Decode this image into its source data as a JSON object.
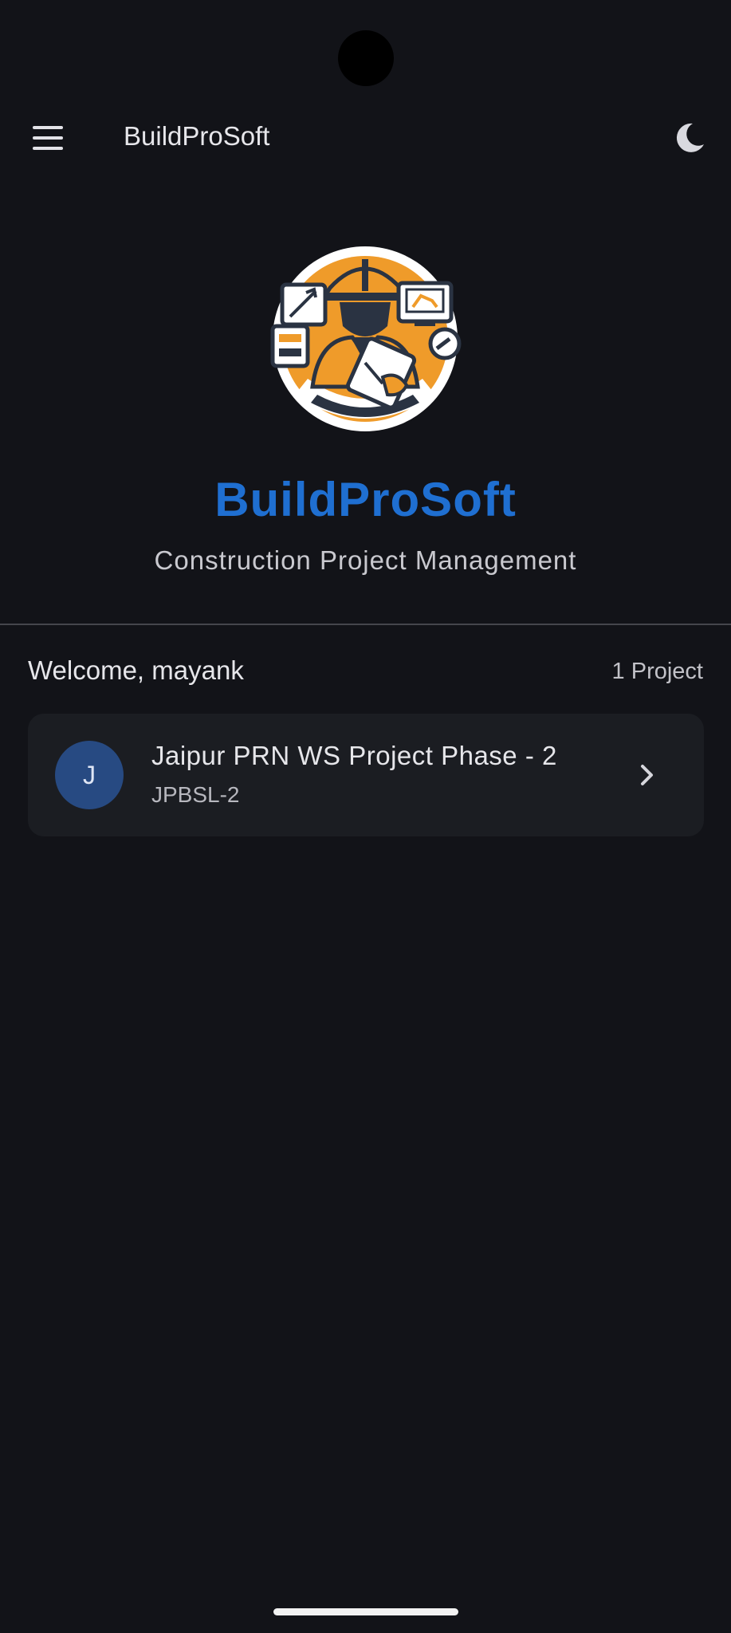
{
  "app_bar": {
    "title": "BuildProSoft",
    "menu_icon": "menu-icon",
    "theme_icon": "moon-icon"
  },
  "brand": {
    "title": "BuildProSoft",
    "subtitle": "Construction Project Management",
    "title_color": "#1f6fd1",
    "logo": "construction-worker-logo"
  },
  "welcome": {
    "greeting": "Welcome, mayank",
    "project_count": "1 Project"
  },
  "projects": [
    {
      "avatar_letter": "J",
      "name": "Jaipur PRN WS Project Phase - 2",
      "code": "JPBSL-2",
      "icon": "chevron-right-icon"
    }
  ],
  "colors": {
    "background": "#121318",
    "card": "#1b1d22",
    "avatar": "#274a82",
    "logo_orange": "#ef9b2a"
  }
}
